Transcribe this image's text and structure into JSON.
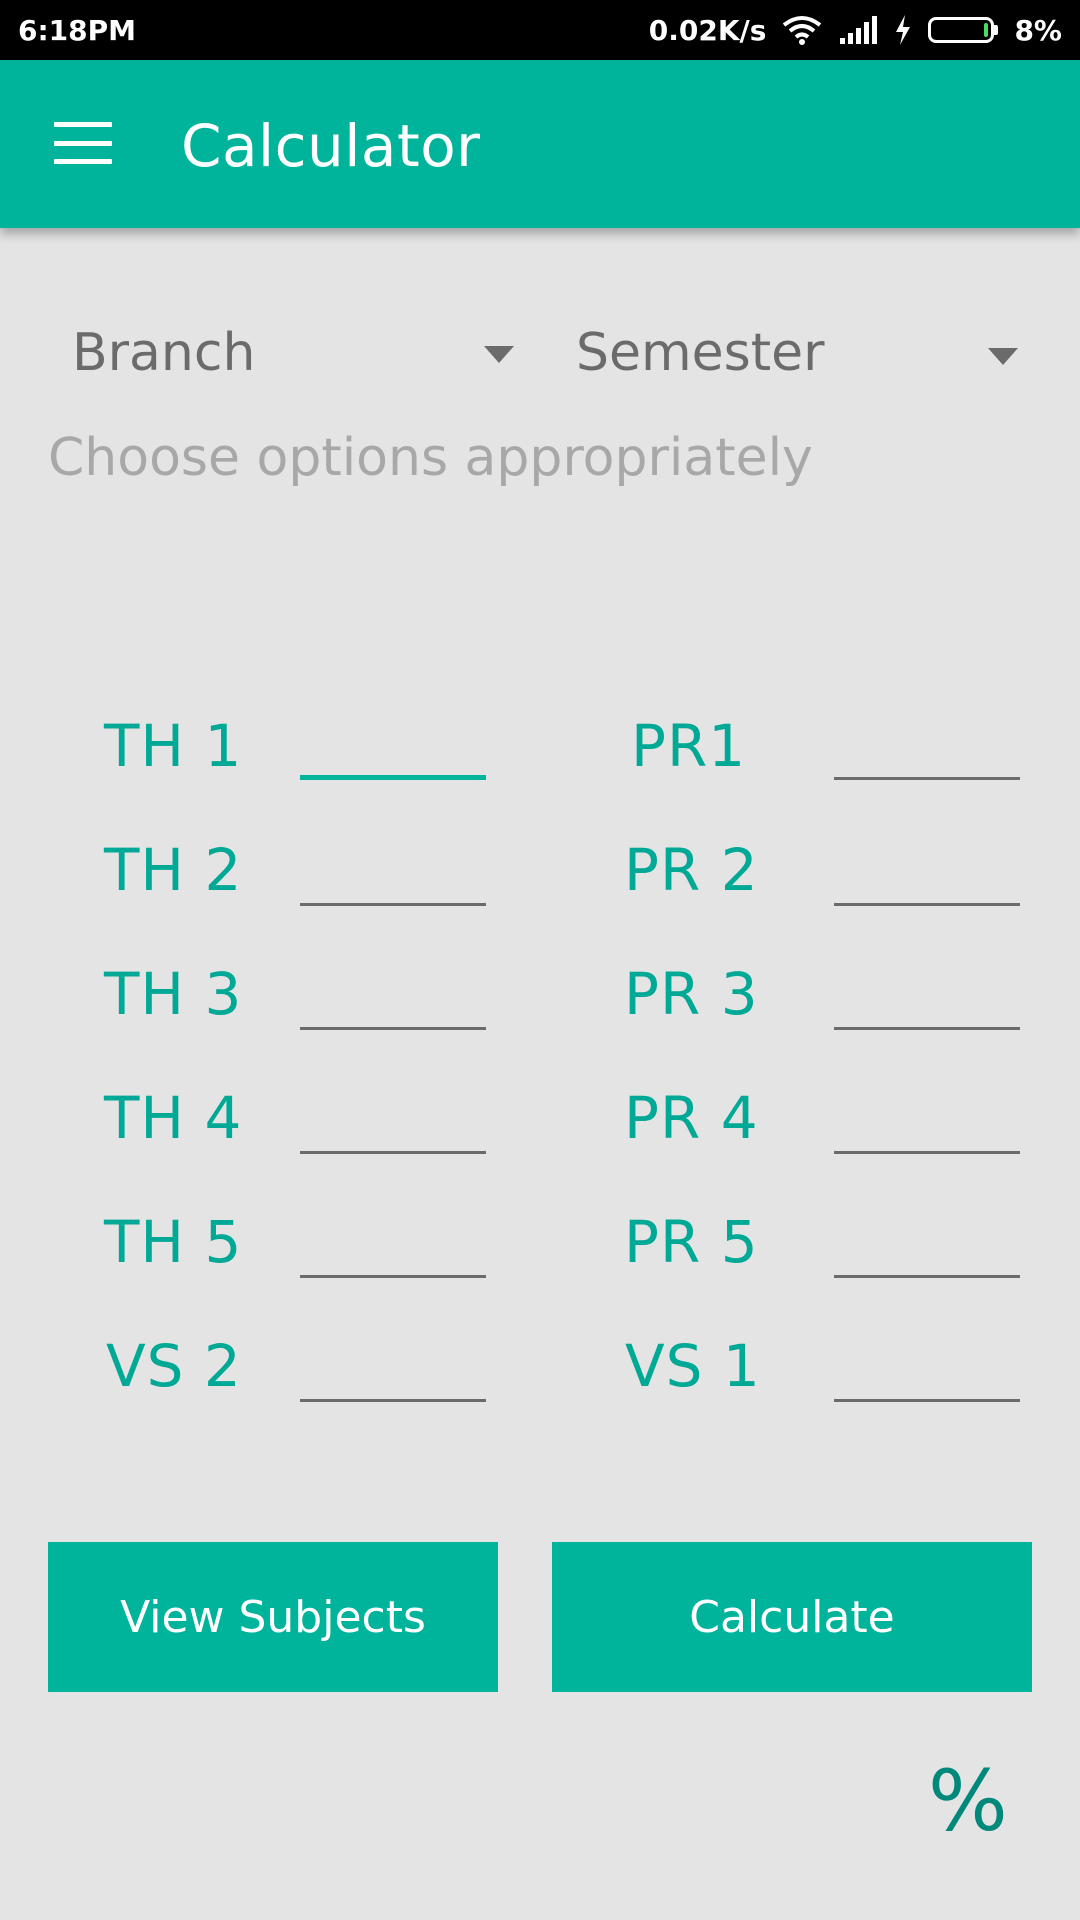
{
  "status_bar": {
    "time": "6:18PM",
    "network_speed": "0.02K/s",
    "battery_percent": "8%",
    "battery_level": 0.08,
    "icons": [
      "wifi-icon",
      "signal-icon",
      "charging-icon",
      "battery-icon"
    ]
  },
  "app_bar": {
    "title": "Calculator",
    "menu_icon": "menu-icon"
  },
  "spinners": {
    "branch": "Branch",
    "semester": "Semester"
  },
  "hint": "Choose options appropriately",
  "theory_rows": [
    {
      "label": "TH 1",
      "value": ""
    },
    {
      "label": "TH 2",
      "value": ""
    },
    {
      "label": "TH 3",
      "value": ""
    },
    {
      "label": "TH 4",
      "value": ""
    },
    {
      "label": "TH 5",
      "value": ""
    },
    {
      "label": "VS 2",
      "value": ""
    }
  ],
  "practical_rows": [
    {
      "label": "PR1",
      "value": ""
    },
    {
      "label": "PR 2",
      "value": ""
    },
    {
      "label": "PR 3",
      "value": ""
    },
    {
      "label": "PR 4",
      "value": ""
    },
    {
      "label": "PR 5",
      "value": ""
    },
    {
      "label": "VS 1",
      "value": ""
    }
  ],
  "buttons": {
    "view_subjects": "View Subjects",
    "calculate": "Calculate"
  },
  "result": {
    "unit": "%"
  },
  "colors": {
    "accent": "#00b39b",
    "label": "#00a995",
    "background": "#e4e4e4"
  }
}
